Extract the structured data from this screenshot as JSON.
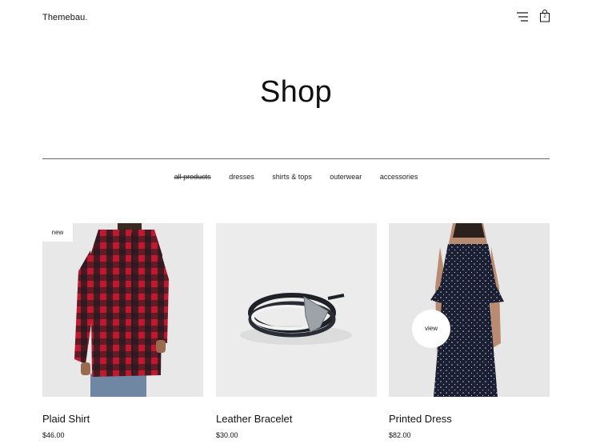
{
  "header": {
    "logo": "Themebau.",
    "menu_icon": "hamburger-menu-icon",
    "cart_icon": "shopping-bag-icon",
    "cart_count": "2"
  },
  "page": {
    "title": "Shop"
  },
  "filters": [
    {
      "label": "all products",
      "active": true
    },
    {
      "label": "dresses",
      "active": false
    },
    {
      "label": "shirts & tops",
      "active": false
    },
    {
      "label": "outerwear",
      "active": false
    },
    {
      "label": "accessories",
      "active": false
    }
  ],
  "products": [
    {
      "name": "Plaid Shirt",
      "price": "$46.00",
      "badge": "new"
    },
    {
      "name": "Leather Bracelet",
      "price": "$30.00"
    },
    {
      "name": "Printed Dress",
      "price": "$82.00",
      "overlay_label": "view"
    }
  ],
  "colors": {
    "background": "#ffffff",
    "text": "#111111",
    "image_bg": "#e9e9e9",
    "divider": "#6b6b6b"
  }
}
